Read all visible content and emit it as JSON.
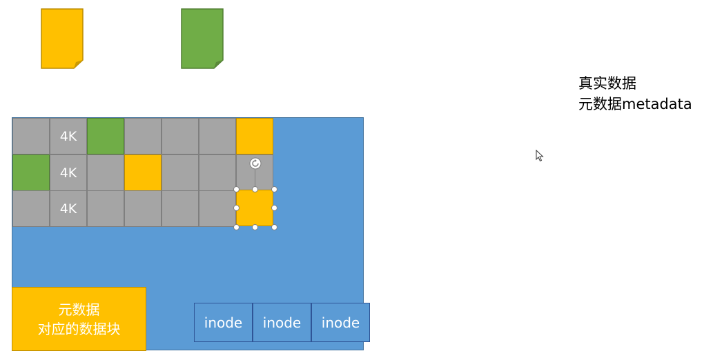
{
  "colors": {
    "disk_background": "#5B9BD5",
    "block_gray": "#A5A5A5",
    "block_yellow": "#FFC000",
    "block_green": "#70AD47"
  },
  "icons": [
    "yellow-document-icon",
    "green-document-icon",
    "rotate-handle-icon",
    "mouse-cursor-icon"
  ],
  "blocks": {
    "row1_label": "4K",
    "row2_label": "4K",
    "row3_label": "4K"
  },
  "metadata_block": {
    "line1": "元数据",
    "line2": "对应的数据块"
  },
  "inodes": [
    "inode",
    "inode",
    "inode"
  ],
  "legend": {
    "real_data": "真实数据",
    "metadata": "元数据metadata"
  }
}
